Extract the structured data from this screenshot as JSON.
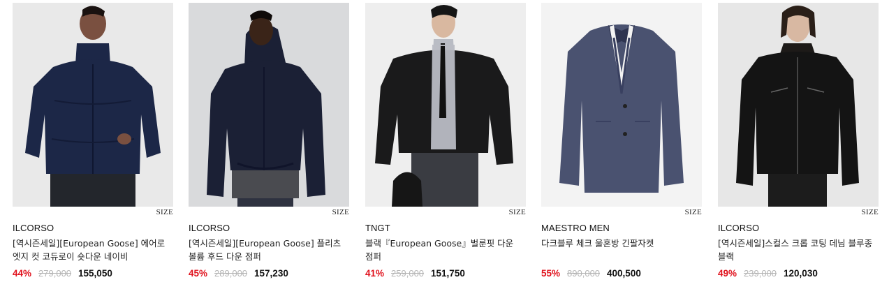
{
  "products": [
    {
      "size_label": "SIZE",
      "brand": "ILCORSO",
      "name": "[역시즌세일][European Goose] 에어로 엣지 컷 코듀로이 숏다운 네이비",
      "discount": "44%",
      "original_price": "279,000",
      "sale_price": "155,050",
      "image_icon": "navy-corduroy-down-jacket-photo",
      "bg_color": "#e9e9e9",
      "garment_color": "#1c2747"
    },
    {
      "size_label": "SIZE",
      "brand": "ILCORSO",
      "name": "[역시즌세일][European Goose] 플리츠 볼륨 후드 다운 점퍼",
      "discount": "45%",
      "original_price": "289,000",
      "sale_price": "157,230",
      "image_icon": "hooded-navy-down-jumper-photo",
      "bg_color": "#d9dadc",
      "garment_color": "#1b2035"
    },
    {
      "size_label": "SIZE",
      "brand": "TNGT",
      "name": "블랙『European Goose』벌룬핏 다운 점퍼",
      "discount": "41%",
      "original_price": "259,000",
      "sale_price": "151,750",
      "image_icon": "black-balloon-down-jumper-photo",
      "bg_color": "#eeeeee",
      "garment_color": "#1a1a1b"
    },
    {
      "size_label": "SIZE",
      "brand": "MAESTRO MEN",
      "name": "다크블루 체크 울혼방 긴팔자켓",
      "discount": "55%",
      "original_price": "890,000",
      "sale_price": "400,500",
      "image_icon": "dark-blue-check-blazer-photo",
      "bg_color": "#f3f3f3",
      "garment_color": "#4a5270"
    },
    {
      "size_label": "SIZE",
      "brand": "ILCORSO",
      "name": "[역시즌세일]스컬스 크롭 코팅 데님 블루종 블랙",
      "discount": "49%",
      "original_price": "239,000",
      "sale_price": "120,030",
      "image_icon": "black-coated-denim-blouson-photo",
      "bg_color": "#e7e7e7",
      "garment_color": "#141414"
    }
  ]
}
